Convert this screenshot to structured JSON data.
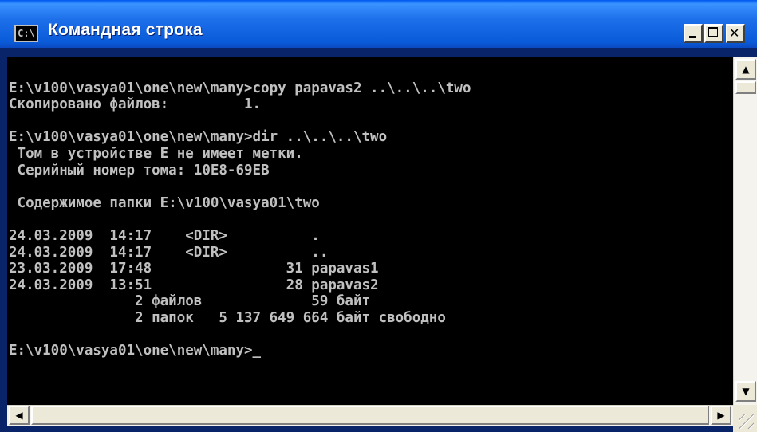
{
  "window": {
    "title": "Командная строка",
    "icon_text": "C:\\"
  },
  "console": {
    "lines": [
      "",
      "E:\\v100\\vasya01\\one\\new\\many>copy papavas2 ..\\..\\..\\two",
      "Скопировано файлов:         1.",
      "",
      "E:\\v100\\vasya01\\one\\new\\many>dir ..\\..\\..\\two",
      " Том в устройстве E не имеет метки.",
      " Серийный номер тома: 10E8-69EB",
      "",
      " Содержимое папки E:\\v100\\vasya01\\two",
      "",
      "24.03.2009  14:17    <DIR>          .",
      "24.03.2009  14:17    <DIR>          ..",
      "23.03.2009  17:48                31 papavas1",
      "24.03.2009  13:51                28 papavas2",
      "               2 файлов             59 байт",
      "               2 папок   5 137 649 664 байт свободно",
      "",
      "E:\\v100\\vasya01\\one\\new\\many>_"
    ]
  },
  "scrollbar": {
    "up_arrow": "▲",
    "down_arrow": "▼",
    "left_arrow": "◀",
    "right_arrow": "▶"
  }
}
